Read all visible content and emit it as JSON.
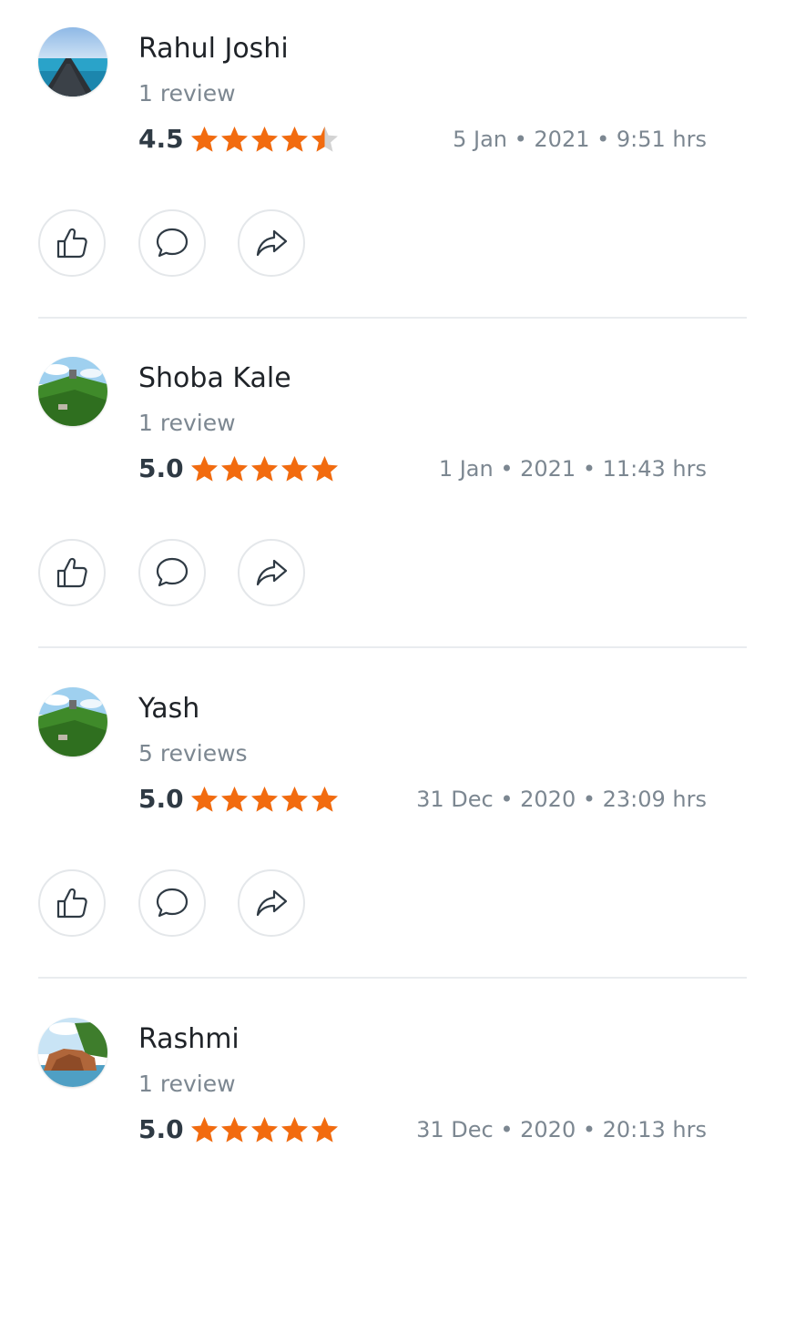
{
  "colors": {
    "star": "#f26b0f",
    "star_empty": "#d3d3d3",
    "name": "#1f2328",
    "muted": "#7c8791",
    "score": "#2f3a44"
  },
  "icons": {
    "like": "thumbs-up-icon",
    "comment": "comment-bubble-icon",
    "share": "share-arrow-icon",
    "star": "star-icon"
  },
  "reviews": [
    {
      "name": "Rahul Joshi",
      "review_count": "1 review",
      "rating": "4.5",
      "stars": 4.5,
      "date": "5 Jan • 2021 • 9:51 hrs",
      "avatar": "pier-ocean"
    },
    {
      "name": "Shoba Kale",
      "review_count": "1 review",
      "rating": "5.0",
      "stars": 5,
      "date": "1 Jan • 2021 • 11:43 hrs",
      "avatar": "green-hill"
    },
    {
      "name": "Yash",
      "review_count": "5 reviews",
      "rating": "5.0",
      "stars": 5,
      "date": "31 Dec • 2020 • 23:09 hrs",
      "avatar": "green-hill"
    },
    {
      "name": "Rashmi",
      "review_count": "1 review",
      "rating": "5.0",
      "stars": 5,
      "date": "31 Dec • 2020 • 20:13 hrs",
      "avatar": "rock-sea"
    }
  ]
}
